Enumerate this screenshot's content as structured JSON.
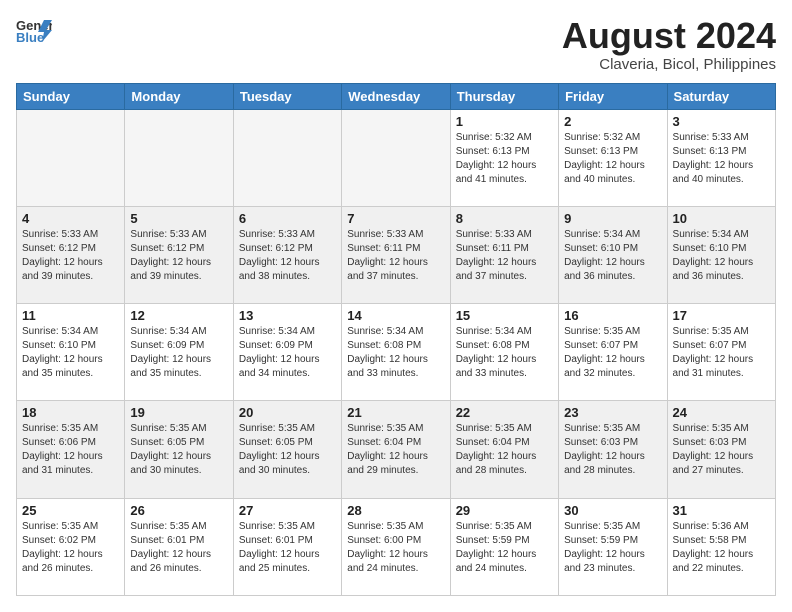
{
  "header": {
    "logo_general": "General",
    "logo_blue": "Blue",
    "main_title": "August 2024",
    "subtitle": "Claveria, Bicol, Philippines"
  },
  "weekdays": [
    "Sunday",
    "Monday",
    "Tuesday",
    "Wednesday",
    "Thursday",
    "Friday",
    "Saturday"
  ],
  "weeks": [
    [
      {
        "day": "",
        "info": "",
        "empty": true
      },
      {
        "day": "",
        "info": "",
        "empty": true
      },
      {
        "day": "",
        "info": "",
        "empty": true
      },
      {
        "day": "",
        "info": "",
        "empty": true
      },
      {
        "day": "1",
        "info": "Sunrise: 5:32 AM\nSunset: 6:13 PM\nDaylight: 12 hours\nand 41 minutes."
      },
      {
        "day": "2",
        "info": "Sunrise: 5:32 AM\nSunset: 6:13 PM\nDaylight: 12 hours\nand 40 minutes."
      },
      {
        "day": "3",
        "info": "Sunrise: 5:33 AM\nSunset: 6:13 PM\nDaylight: 12 hours\nand 40 minutes."
      }
    ],
    [
      {
        "day": "4",
        "info": "Sunrise: 5:33 AM\nSunset: 6:12 PM\nDaylight: 12 hours\nand 39 minutes.",
        "shaded": true
      },
      {
        "day": "5",
        "info": "Sunrise: 5:33 AM\nSunset: 6:12 PM\nDaylight: 12 hours\nand 39 minutes.",
        "shaded": true
      },
      {
        "day": "6",
        "info": "Sunrise: 5:33 AM\nSunset: 6:12 PM\nDaylight: 12 hours\nand 38 minutes.",
        "shaded": true
      },
      {
        "day": "7",
        "info": "Sunrise: 5:33 AM\nSunset: 6:11 PM\nDaylight: 12 hours\nand 37 minutes.",
        "shaded": true
      },
      {
        "day": "8",
        "info": "Sunrise: 5:33 AM\nSunset: 6:11 PM\nDaylight: 12 hours\nand 37 minutes.",
        "shaded": true
      },
      {
        "day": "9",
        "info": "Sunrise: 5:34 AM\nSunset: 6:10 PM\nDaylight: 12 hours\nand 36 minutes.",
        "shaded": true
      },
      {
        "day": "10",
        "info": "Sunrise: 5:34 AM\nSunset: 6:10 PM\nDaylight: 12 hours\nand 36 minutes.",
        "shaded": true
      }
    ],
    [
      {
        "day": "11",
        "info": "Sunrise: 5:34 AM\nSunset: 6:10 PM\nDaylight: 12 hours\nand 35 minutes."
      },
      {
        "day": "12",
        "info": "Sunrise: 5:34 AM\nSunset: 6:09 PM\nDaylight: 12 hours\nand 35 minutes."
      },
      {
        "day": "13",
        "info": "Sunrise: 5:34 AM\nSunset: 6:09 PM\nDaylight: 12 hours\nand 34 minutes."
      },
      {
        "day": "14",
        "info": "Sunrise: 5:34 AM\nSunset: 6:08 PM\nDaylight: 12 hours\nand 33 minutes."
      },
      {
        "day": "15",
        "info": "Sunrise: 5:34 AM\nSunset: 6:08 PM\nDaylight: 12 hours\nand 33 minutes."
      },
      {
        "day": "16",
        "info": "Sunrise: 5:35 AM\nSunset: 6:07 PM\nDaylight: 12 hours\nand 32 minutes."
      },
      {
        "day": "17",
        "info": "Sunrise: 5:35 AM\nSunset: 6:07 PM\nDaylight: 12 hours\nand 31 minutes."
      }
    ],
    [
      {
        "day": "18",
        "info": "Sunrise: 5:35 AM\nSunset: 6:06 PM\nDaylight: 12 hours\nand 31 minutes.",
        "shaded": true
      },
      {
        "day": "19",
        "info": "Sunrise: 5:35 AM\nSunset: 6:05 PM\nDaylight: 12 hours\nand 30 minutes.",
        "shaded": true
      },
      {
        "day": "20",
        "info": "Sunrise: 5:35 AM\nSunset: 6:05 PM\nDaylight: 12 hours\nand 30 minutes.",
        "shaded": true
      },
      {
        "day": "21",
        "info": "Sunrise: 5:35 AM\nSunset: 6:04 PM\nDaylight: 12 hours\nand 29 minutes.",
        "shaded": true
      },
      {
        "day": "22",
        "info": "Sunrise: 5:35 AM\nSunset: 6:04 PM\nDaylight: 12 hours\nand 28 minutes.",
        "shaded": true
      },
      {
        "day": "23",
        "info": "Sunrise: 5:35 AM\nSunset: 6:03 PM\nDaylight: 12 hours\nand 28 minutes.",
        "shaded": true
      },
      {
        "day": "24",
        "info": "Sunrise: 5:35 AM\nSunset: 6:03 PM\nDaylight: 12 hours\nand 27 minutes.",
        "shaded": true
      }
    ],
    [
      {
        "day": "25",
        "info": "Sunrise: 5:35 AM\nSunset: 6:02 PM\nDaylight: 12 hours\nand 26 minutes."
      },
      {
        "day": "26",
        "info": "Sunrise: 5:35 AM\nSunset: 6:01 PM\nDaylight: 12 hours\nand 26 minutes."
      },
      {
        "day": "27",
        "info": "Sunrise: 5:35 AM\nSunset: 6:01 PM\nDaylight: 12 hours\nand 25 minutes."
      },
      {
        "day": "28",
        "info": "Sunrise: 5:35 AM\nSunset: 6:00 PM\nDaylight: 12 hours\nand 24 minutes."
      },
      {
        "day": "29",
        "info": "Sunrise: 5:35 AM\nSunset: 5:59 PM\nDaylight: 12 hours\nand 24 minutes."
      },
      {
        "day": "30",
        "info": "Sunrise: 5:35 AM\nSunset: 5:59 PM\nDaylight: 12 hours\nand 23 minutes."
      },
      {
        "day": "31",
        "info": "Sunrise: 5:36 AM\nSunset: 5:58 PM\nDaylight: 12 hours\nand 22 minutes."
      }
    ]
  ]
}
